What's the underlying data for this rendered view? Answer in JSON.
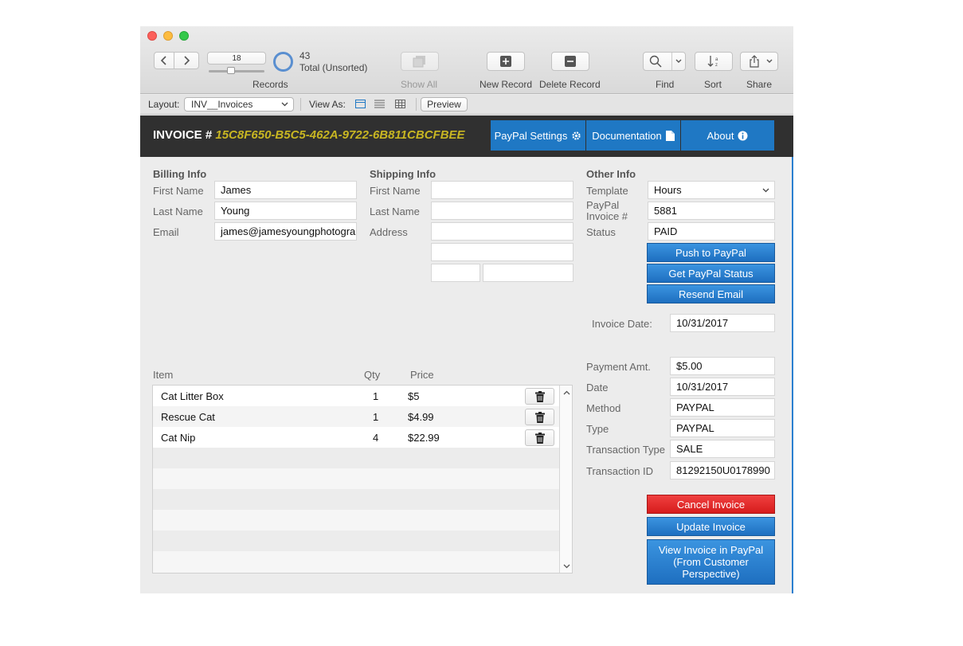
{
  "toolbar": {
    "record_number": "18",
    "record_total": "43",
    "sort_status": "Total (Unsorted)",
    "records_label": "Records",
    "show_all_label": "Show All",
    "new_record_label": "New Record",
    "delete_record_label": "Delete Record",
    "find_label": "Find",
    "sort_label": "Sort",
    "share_label": "Share"
  },
  "layout_bar": {
    "layout_label": "Layout:",
    "layout_value": "INV__Invoices",
    "view_as_label": "View As:",
    "preview_label": "Preview"
  },
  "header": {
    "invoice_prefix": "INVOICE #",
    "invoice_id": "15C8F650-B5C5-462A-9722-6B811CBCFBEE",
    "paypal_settings": "PayPal Settings",
    "documentation": "Documentation",
    "about": "About"
  },
  "billing": {
    "title": "Billing Info",
    "first_name_label": "First Name",
    "first_name": "James",
    "last_name_label": "Last Name",
    "last_name": "Young",
    "email_label": "Email",
    "email": "james@jamesyoungphotogra"
  },
  "shipping": {
    "title": "Shipping Info",
    "first_name_label": "First Name",
    "last_name_label": "Last Name",
    "address_label": "Address"
  },
  "other": {
    "title": "Other Info",
    "template_label": "Template",
    "template_value": "Hours",
    "paypal_invoice_label_1": "PayPal",
    "paypal_invoice_label_2": "Invoice #",
    "paypal_invoice_value": "5881",
    "status_label": "Status",
    "status_value": "PAID",
    "push_btn": "Push to PayPal",
    "get_status_btn": "Get PayPal Status",
    "resend_btn": "Resend Email",
    "invoice_date_label": "Invoice Date:",
    "invoice_date": "10/31/2017"
  },
  "items": {
    "col_item": "Item",
    "col_qty": "Qty",
    "col_price": "Price",
    "rows": [
      {
        "name": "Cat Litter Box",
        "qty": "1",
        "price": "$5"
      },
      {
        "name": "Rescue Cat",
        "qty": "1",
        "price": "$4.99"
      },
      {
        "name": "Cat Nip",
        "qty": "4",
        "price": "$22.99"
      }
    ]
  },
  "payment": {
    "amount_label": "Payment Amt.",
    "amount": "$5.00",
    "date_label": "Date",
    "date": "10/31/2017",
    "method_label": "Method",
    "method": "PAYPAL",
    "type_label": "Type",
    "type": "PAYPAL",
    "transaction_type_label": "Transaction Type",
    "transaction_type": "SALE",
    "transaction_id_label": "Transaction ID",
    "transaction_id": "81292150U0178990"
  },
  "actions": {
    "cancel": "Cancel Invoice",
    "update": "Update Invoice",
    "view_line1": "View Invoice in PayPal",
    "view_line2": "(From Customer",
    "view_line3": "Perspective)"
  },
  "colors": {
    "accent_blue": "#1f78c4",
    "invoice_id_yellow": "#c8b622",
    "cancel_red": "#e12222",
    "header_dark": "#303030"
  }
}
